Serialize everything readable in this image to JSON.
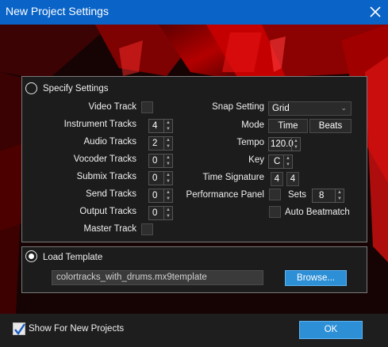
{
  "window": {
    "title": "New Project Settings"
  },
  "colors": {
    "title_bar": "#0a64c8",
    "accent_button": "#2d8fd6",
    "banner": "#c00000"
  },
  "specify": {
    "radio_label": "Specify Settings",
    "video_track": "Video Track",
    "instrument_tracks": {
      "label": "Instrument Tracks",
      "value": "4"
    },
    "audio_tracks": {
      "label": "Audio Tracks",
      "value": "2"
    },
    "vocoder_tracks": {
      "label": "Vocoder Tracks",
      "value": "0"
    },
    "submix_tracks": {
      "label": "Submix Tracks",
      "value": "0"
    },
    "send_tracks": {
      "label": "Send Tracks",
      "value": "0"
    },
    "output_tracks": {
      "label": "Output Tracks",
      "value": "0"
    },
    "master_track": "Master Track",
    "snap_setting": {
      "label": "Snap Setting",
      "value": "Grid"
    },
    "mode": {
      "label": "Mode",
      "time": "Time",
      "beats": "Beats"
    },
    "tempo": {
      "label": "Tempo",
      "value": "120.0"
    },
    "key": {
      "label": "Key",
      "value": "C"
    },
    "time_signature": {
      "label": "Time Signature",
      "numerator": "4",
      "denominator": "4"
    },
    "performance_panel": {
      "label": "Performance Panel",
      "sets_label": "Sets",
      "sets_value": "8"
    },
    "auto_beatmatch": "Auto Beatmatch"
  },
  "template": {
    "radio_label": "Load Template",
    "path": "colortracks_with_drums.mx9template",
    "browse": "Browse..."
  },
  "footer": {
    "show_for_new": "Show For New Projects",
    "ok": "OK"
  }
}
